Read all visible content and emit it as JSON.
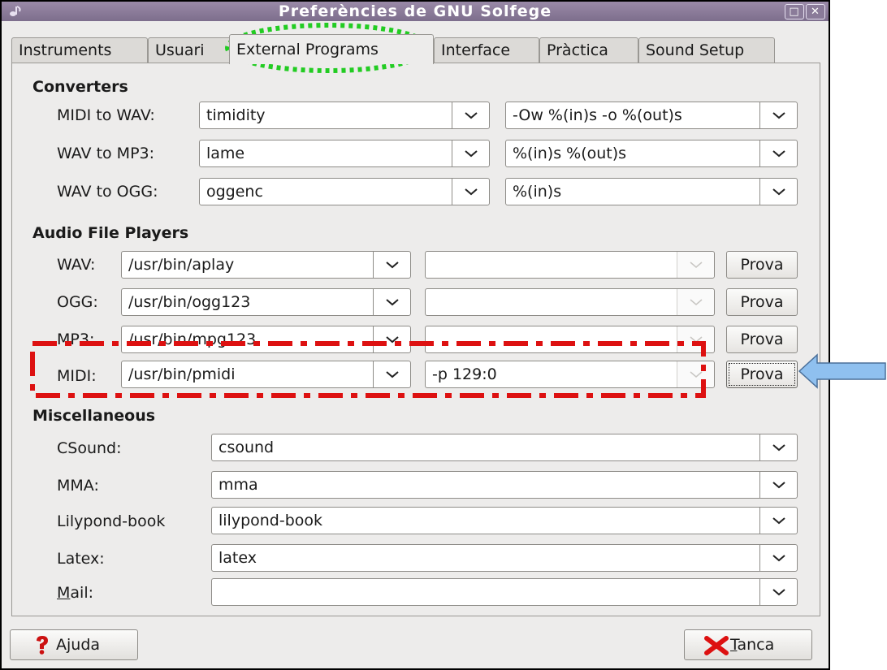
{
  "window": {
    "title": "Preferències de GNU Solfege"
  },
  "tabs": [
    {
      "label": "Instruments"
    },
    {
      "label": "Usuari"
    },
    {
      "label": "External Programs"
    },
    {
      "label": "Interface"
    },
    {
      "label": "Pràctica"
    },
    {
      "label": "Sound Setup"
    }
  ],
  "converters": {
    "title": "Converters",
    "rows": [
      {
        "label": "MIDI to WAV:",
        "program": "timidity",
        "args": "-Ow %(in)s -o %(out)s"
      },
      {
        "label": "WAV to MP3:",
        "program": "lame",
        "args": "%(in)s %(out)s"
      },
      {
        "label": "WAV to OGG:",
        "program": "oggenc",
        "args": "%(in)s"
      }
    ]
  },
  "players": {
    "title": "Audio File Players",
    "test_label": "Prova",
    "rows": [
      {
        "label": "WAV:",
        "program": "/usr/bin/aplay",
        "args": ""
      },
      {
        "label": "OGG:",
        "program": "/usr/bin/ogg123",
        "args": ""
      },
      {
        "label": "MP3:",
        "program": "/usr/bin/mpg123",
        "args": ""
      },
      {
        "label": "MIDI:",
        "program": "/usr/bin/pmidi",
        "args": "-p 129:0"
      }
    ]
  },
  "misc": {
    "title": "Miscellaneous",
    "rows": [
      {
        "label": "CSound:",
        "value": "csound"
      },
      {
        "label": "MMA:",
        "value": "mma"
      },
      {
        "label": "Lilypond-book",
        "value": "lilypond-book"
      },
      {
        "label": "Latex:",
        "value": "latex"
      },
      {
        "label_mnemonic": "M",
        "label_rest": "ail:",
        "value": ""
      }
    ]
  },
  "footer": {
    "help_mnemonic_pre": "A",
    "help_mnemonic": "j",
    "help_rest": "uda",
    "close_mnemonic": "T",
    "close_rest": "anca"
  },
  "annotations": {
    "tab_highlight_color": "#22cc22",
    "midi_row_highlight_color": "#dd1111",
    "arrow_color": "#8fc0ef"
  }
}
